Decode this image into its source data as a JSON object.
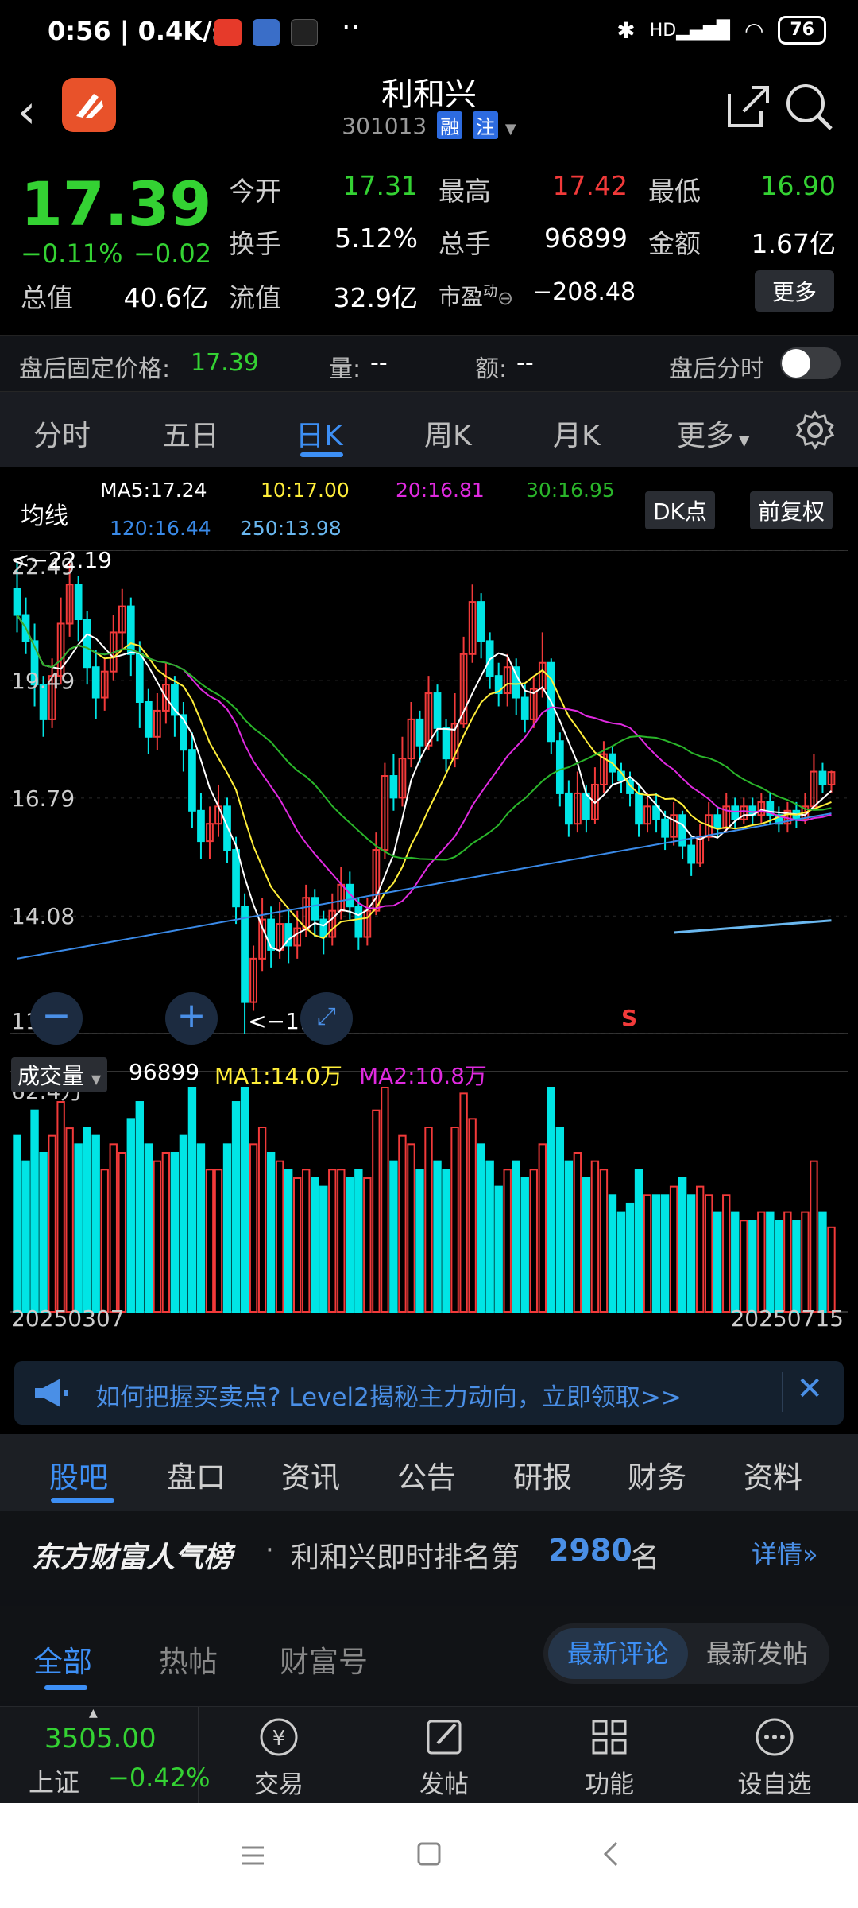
{
  "status_bar": {
    "time": "0:56 | 0.4K/s",
    "battery": "76",
    "signal_label": "HD"
  },
  "header": {
    "title": "利和兴",
    "code": "301013",
    "tag_margin": "融",
    "tag_watch": "注"
  },
  "quote": {
    "price": "17.39",
    "change_pct": "−0.11%",
    "change_abs": "−0.02",
    "open_label": "今开",
    "open_value": "17.31",
    "high_label": "最高",
    "high_value": "17.42",
    "low_label": "最低",
    "low_value": "16.90",
    "turnover_label": "换手",
    "turnover_value": "5.12%",
    "volume_label": "总手",
    "volume_value": "96899",
    "amount_label": "金额",
    "amount_value": "1.67亿",
    "mktcap_label": "总值",
    "mktcap_value": "40.6亿",
    "float_label": "流值",
    "float_value": "32.9亿",
    "pe_label": "市盈",
    "pe_sup": "动",
    "pe_value": "−208.48",
    "more_label": "更多"
  },
  "after_hours": {
    "price_label": "盘后固定价格:",
    "price_value": "17.39",
    "vol_label": "量:",
    "vol_value": "--",
    "amt_label": "额:",
    "amt_value": "--",
    "timeshare_label": "盘后分时"
  },
  "chart_tabs": [
    "分时",
    "五日",
    "日K",
    "周K",
    "月K",
    "更多"
  ],
  "ma": {
    "label": "均线",
    "ma5": "MA5:17.24",
    "ma10": "10:17.00",
    "ma20": "20:16.81",
    "ma30": "30:16.95",
    "ma120": "120:16.44",
    "ma250": "250:13.98",
    "dk_label": "DK点",
    "adjust_label": "前复权"
  },
  "price_axis": [
    "22.49",
    "19.49",
    "16.79",
    "14.08",
    "11.38"
  ],
  "markers": {
    "high": "<−22.19",
    "low": "<−11.38",
    "signal": "S"
  },
  "volume": {
    "label": "成交量",
    "value": "96899",
    "ma1": "MA1:14.0万",
    "ma2": "MA2:10.8万",
    "axis_max": "62.4万"
  },
  "dates": {
    "start": "20250307",
    "end": "20250715"
  },
  "colors": {
    "up": "#f23a3a",
    "down": "#00e5e5",
    "ma5": "#ffffff",
    "ma10": "#ffee3a",
    "ma20": "#e02ae0",
    "ma30": "#2ab52a",
    "ma120": "#3a8ae8",
    "ma250": "#6ab8f0"
  },
  "ad": {
    "text": "如何把握买卖点? Level2揭秘主力动向，立即领取>>"
  },
  "section_tabs": [
    "股吧",
    "盘口",
    "资讯",
    "公告",
    "研报",
    "财务",
    "资料"
  ],
  "rank": {
    "brand": "东方财富人气榜",
    "sep": "·",
    "text": "利和兴即时排名第",
    "number": "2980",
    "unit": "名",
    "detail": "详情"
  },
  "feed_tabs": [
    "全部",
    "热帖",
    "财富号"
  ],
  "sort_options": [
    "最新评论",
    "最新发帖"
  ],
  "index": {
    "value": "3505.00",
    "name": "上证",
    "change": "−0.42%"
  },
  "bottom_nav": [
    "交易",
    "发帖",
    "功能",
    "设自选"
  ],
  "chart_data": {
    "type": "candlestick",
    "x": [
      "20250307",
      "20250715"
    ],
    "ylim": [
      11.38,
      22.49
    ],
    "y_ticks": [
      22.49,
      19.49,
      16.79,
      14.08,
      11.38
    ],
    "high_marker": 22.19,
    "low_marker": 11.38,
    "candles": [
      [
        21.6,
        21.0,
        22.2,
        20.6
      ],
      [
        21.0,
        20.4,
        21.4,
        20.1
      ],
      [
        20.4,
        19.4,
        20.8,
        18.9
      ],
      [
        19.4,
        18.6,
        19.6,
        18.2
      ],
      [
        18.6,
        19.6,
        20.0,
        18.4
      ],
      [
        19.6,
        20.8,
        21.4,
        19.4
      ],
      [
        20.8,
        21.7,
        22.19,
        20.5
      ],
      [
        21.7,
        20.9,
        21.9,
        20.4
      ],
      [
        20.9,
        19.8,
        21.1,
        19.4
      ],
      [
        19.8,
        19.1,
        20.2,
        18.6
      ],
      [
        19.1,
        19.7,
        20.0,
        18.8
      ],
      [
        19.7,
        20.6,
        21.0,
        19.5
      ],
      [
        20.6,
        21.2,
        21.6,
        20.2
      ],
      [
        21.2,
        20.1,
        21.4,
        19.6
      ],
      [
        20.1,
        19.0,
        20.4,
        18.4
      ],
      [
        19.0,
        18.2,
        19.3,
        17.8
      ],
      [
        18.2,
        18.8,
        19.2,
        17.9
      ],
      [
        18.8,
        19.4,
        19.9,
        18.5
      ],
      [
        19.4,
        18.7,
        19.6,
        18.2
      ],
      [
        18.7,
        17.9,
        19.0,
        17.4
      ],
      [
        17.9,
        16.5,
        18.3,
        16.1
      ],
      [
        16.5,
        15.8,
        16.9,
        15.4
      ],
      [
        15.8,
        16.2,
        16.6,
        15.4
      ],
      [
        16.2,
        16.6,
        17.1,
        15.9
      ],
      [
        16.6,
        15.6,
        16.8,
        15.3
      ],
      [
        15.6,
        14.3,
        15.9,
        13.9
      ],
      [
        14.3,
        12.1,
        14.6,
        11.38
      ],
      [
        12.1,
        13.1,
        13.4,
        11.9
      ],
      [
        13.1,
        14.0,
        14.5,
        12.8
      ],
      [
        14.0,
        13.3,
        14.3,
        12.9
      ],
      [
        13.3,
        13.9,
        14.4,
        13.1
      ],
      [
        13.9,
        13.4,
        14.2,
        13.0
      ],
      [
        13.4,
        13.8,
        14.2,
        13.1
      ],
      [
        13.8,
        14.5,
        14.8,
        13.6
      ],
      [
        14.5,
        14.0,
        14.7,
        13.6
      ],
      [
        14.0,
        13.6,
        14.2,
        13.2
      ],
      [
        13.6,
        14.2,
        14.6,
        13.4
      ],
      [
        14.2,
        14.8,
        15.2,
        14.0
      ],
      [
        14.8,
        14.3,
        15.1,
        14.0
      ],
      [
        14.3,
        13.6,
        14.5,
        13.3
      ],
      [
        13.6,
        14.2,
        14.5,
        13.4
      ],
      [
        14.2,
        15.6,
        16.0,
        14.1
      ],
      [
        15.6,
        17.3,
        17.6,
        15.4
      ],
      [
        17.3,
        16.8,
        17.8,
        16.5
      ],
      [
        16.8,
        17.7,
        18.2,
        16.6
      ],
      [
        17.7,
        18.6,
        19.0,
        17.5
      ],
      [
        18.6,
        18.0,
        18.8,
        17.6
      ],
      [
        18.0,
        19.2,
        19.6,
        17.9
      ],
      [
        19.2,
        18.4,
        19.4,
        18.1
      ],
      [
        18.4,
        17.7,
        18.6,
        17.4
      ],
      [
        17.7,
        18.5,
        19.2,
        17.5
      ],
      [
        18.5,
        20.1,
        20.5,
        18.4
      ],
      [
        20.1,
        21.3,
        21.7,
        19.9
      ],
      [
        21.3,
        20.4,
        21.5,
        20.0
      ],
      [
        20.4,
        19.6,
        20.6,
        19.3
      ],
      [
        19.6,
        19.2,
        19.9,
        18.9
      ],
      [
        19.2,
        19.8,
        20.1,
        18.9
      ],
      [
        19.8,
        19.1,
        20.0,
        18.7
      ],
      [
        19.1,
        18.6,
        19.4,
        18.3
      ],
      [
        18.6,
        19.3,
        19.6,
        18.4
      ],
      [
        19.3,
        19.9,
        20.6,
        19.1
      ],
      [
        19.9,
        18.1,
        20.0,
        17.8
      ],
      [
        18.1,
        16.9,
        18.3,
        16.6
      ],
      [
        16.9,
        16.2,
        17.2,
        15.9
      ],
      [
        16.2,
        16.9,
        17.4,
        16.0
      ],
      [
        16.9,
        16.3,
        17.1,
        16.0
      ],
      [
        16.3,
        17.1,
        17.5,
        16.2
      ],
      [
        17.1,
        17.8,
        18.1,
        16.9
      ],
      [
        17.8,
        17.4,
        18.0,
        17.1
      ],
      [
        17.4,
        17.2,
        17.6,
        16.9
      ],
      [
        17.2,
        16.9,
        17.4,
        16.6
      ],
      [
        16.9,
        16.2,
        17.1,
        15.9
      ],
      [
        16.2,
        16.6,
        16.9,
        16.0
      ],
      [
        16.6,
        16.3,
        16.9,
        16.0
      ],
      [
        16.3,
        15.9,
        16.5,
        15.6
      ],
      [
        15.9,
        16.4,
        16.7,
        15.7
      ],
      [
        16.4,
        15.7,
        16.5,
        15.4
      ],
      [
        15.7,
        15.3,
        15.9,
        15.0
      ],
      [
        15.3,
        15.9,
        16.2,
        15.2
      ],
      [
        15.9,
        16.4,
        16.7,
        15.8
      ],
      [
        16.4,
        16.1,
        16.6,
        15.9
      ],
      [
        16.1,
        16.6,
        16.9,
        16.0
      ],
      [
        16.6,
        16.3,
        16.8,
        16.1
      ],
      [
        16.3,
        16.6,
        16.8,
        16.2
      ],
      [
        16.6,
        16.4,
        16.8,
        16.2
      ],
      [
        16.4,
        16.7,
        16.9,
        16.2
      ],
      [
        16.7,
        16.4,
        16.9,
        16.2
      ],
      [
        16.4,
        16.2,
        16.6,
        16.0
      ],
      [
        16.2,
        16.5,
        16.7,
        16.0
      ],
      [
        16.5,
        16.3,
        16.7,
        16.1
      ],
      [
        16.3,
        16.6,
        16.9,
        16.2
      ],
      [
        16.6,
        17.4,
        17.8,
        16.5
      ],
      [
        17.4,
        17.1,
        17.6,
        16.9
      ],
      [
        17.1,
        17.39,
        17.42,
        16.9
      ]
    ],
    "ma5_last": 17.24,
    "ma10_last": 17.0,
    "ma20_last": 16.81,
    "ma30_last": 16.95,
    "ma120_last": 16.44,
    "ma250_last": 13.98,
    "volume_max": 624000,
    "volume_last": 96899
  }
}
